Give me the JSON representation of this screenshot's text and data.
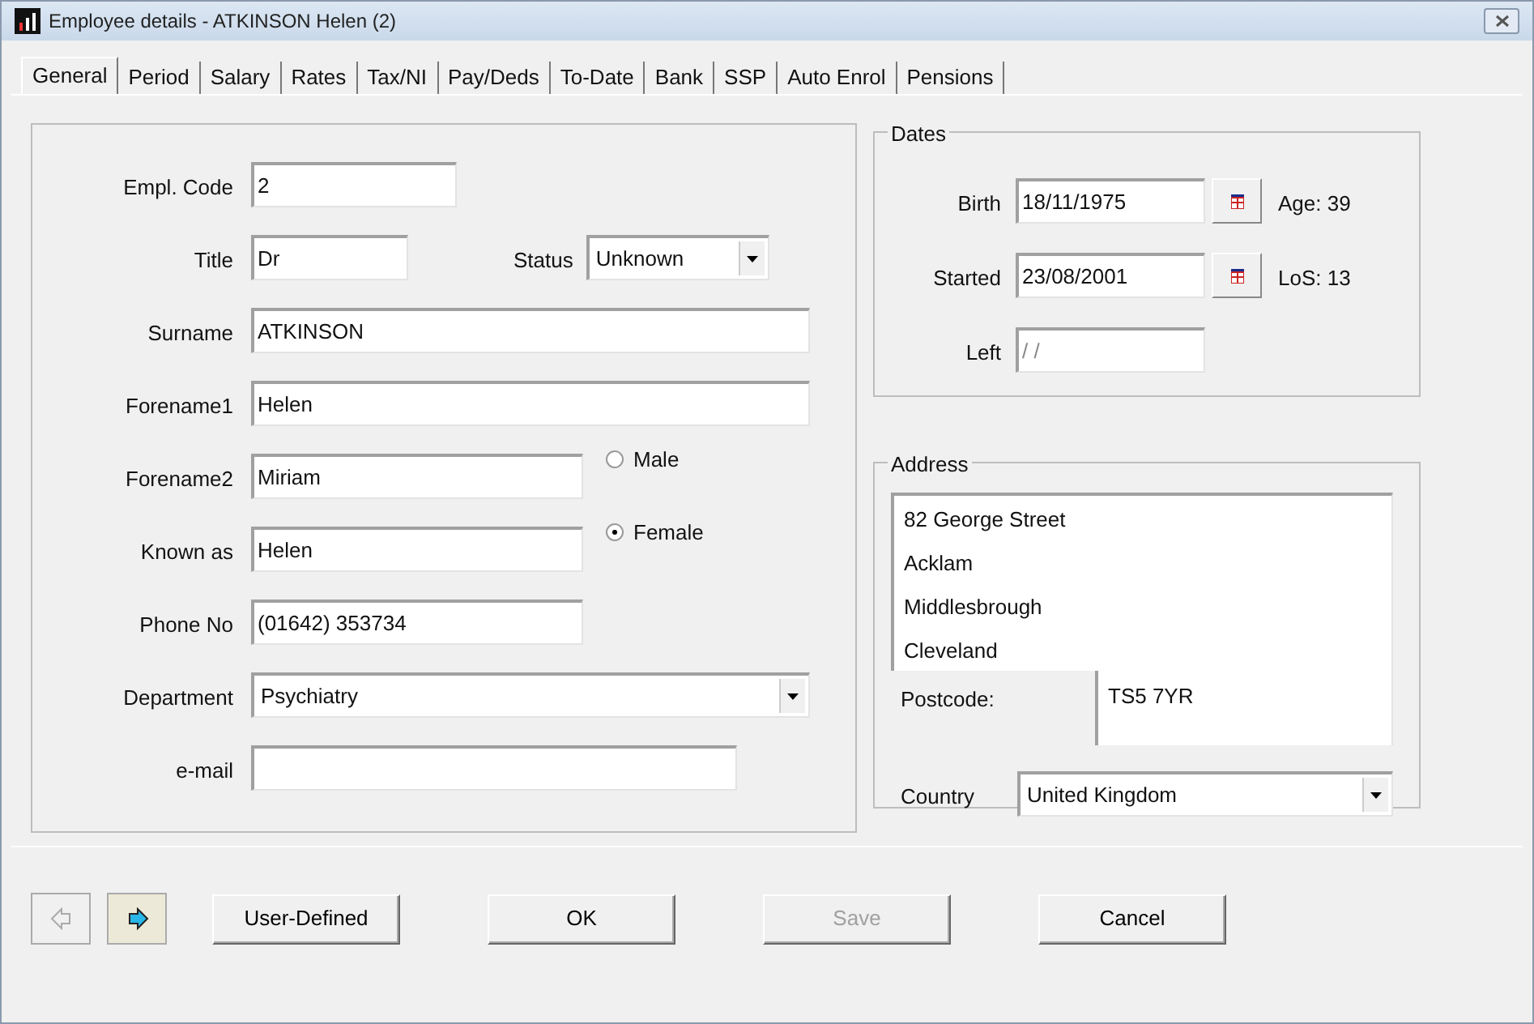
{
  "window": {
    "title": "Employee details - ATKINSON Helen (2)"
  },
  "tabs": [
    {
      "label": "General",
      "selected": true
    },
    {
      "label": "Period",
      "selected": false
    },
    {
      "label": "Salary",
      "selected": false
    },
    {
      "label": "Rates",
      "selected": false
    },
    {
      "label": "Tax/NI",
      "selected": false
    },
    {
      "label": "Pay/Deds",
      "selected": false
    },
    {
      "label": "To-Date",
      "selected": false
    },
    {
      "label": "Bank",
      "selected": false
    },
    {
      "label": "SSP",
      "selected": false
    },
    {
      "label": "Auto Enrol",
      "selected": false
    },
    {
      "label": "Pensions",
      "selected": false
    }
  ],
  "personal": {
    "fields": [
      {
        "kind": "text",
        "label": "Empl. Code",
        "value": "2"
      },
      {
        "kind": "text",
        "label": "Title",
        "value": "Dr"
      },
      {
        "kind": "text",
        "label": "Surname",
        "value": "ATKINSON"
      },
      {
        "kind": "text",
        "label": "Forename1",
        "value": "Helen"
      },
      {
        "kind": "text",
        "label": "Forename2",
        "value": "Miriam"
      },
      {
        "kind": "text",
        "label": "Known as",
        "value": "Helen"
      },
      {
        "kind": "text",
        "label": "Phone No",
        "value": "(01642) 353734"
      },
      {
        "kind": "select",
        "label": "Department",
        "value": "Psychiatry"
      },
      {
        "kind": "text",
        "label": "e-mail"
      }
    ],
    "status": {
      "label": "Status",
      "value": "Unknown"
    },
    "gender": [
      {
        "label": "Male",
        "selected": false
      },
      {
        "label": "Female",
        "selected": true
      }
    ]
  },
  "dates": {
    "title": "Dates",
    "rows": [
      {
        "label": "Birth",
        "value": "18/11/1975",
        "calendar": true,
        "info": "Age: 39"
      },
      {
        "label": "Started",
        "value": "23/08/2001",
        "calendar": true,
        "info": "LoS: 13"
      },
      {
        "label": "Left",
        "value": "/ /",
        "calendar": false
      }
    ]
  },
  "address": {
    "title": "Address",
    "lines": [
      "82 George Street",
      "Acklam",
      "Middlesbrough",
      "Cleveland"
    ],
    "postcode": {
      "label": "Postcode:",
      "value": "TS5 7YR"
    },
    "country": {
      "label": "Country",
      "value": "United Kingdom"
    }
  },
  "navigation": [
    {
      "kind": "back",
      "disabled": true
    },
    {
      "kind": "forward",
      "disabled": false
    }
  ],
  "buttons": [
    {
      "label": "User-Defined",
      "disabled": false
    },
    {
      "label": "OK",
      "disabled": false
    },
    {
      "label": "Save",
      "disabled": true
    },
    {
      "label": "Cancel",
      "disabled": false
    }
  ]
}
